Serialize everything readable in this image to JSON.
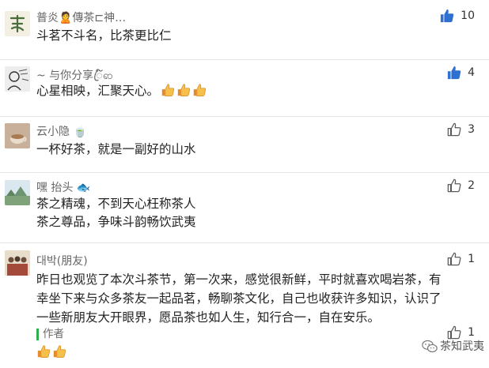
{
  "colors": {
    "like_active": "#2f6fd0",
    "like_inactive": "#5b5b5b",
    "author_tag_bar": "#2eaf4a",
    "name_text": "#666666"
  },
  "comments": [
    {
      "name": "普炎🙎傳茶⊏神…",
      "text_lines": [
        "斗茗不斗名，比茶更比仁"
      ],
      "likes": "10",
      "liked": true,
      "avatar_icon": "tea-character-avatar"
    },
    {
      "name": "~ 与你分享ꦿ໌ၹ",
      "text_lines": [
        "心星相映，汇聚天心。"
      ],
      "likes": "4",
      "liked": true,
      "emoji_count": 3,
      "avatar_icon": "sketch-portrait-avatar"
    },
    {
      "name": "云小隐 🍵",
      "text_lines": [
        "一杯好茶，就是一副好的山水"
      ],
      "likes": "3",
      "liked": false,
      "avatar_icon": "tea-cup-avatar"
    },
    {
      "name": "嘿 抬头 🐟",
      "text_lines": [
        "茶之精魂，不到天心枉称茶人",
        "茶之尊品，争味斗韵畅饮武夷"
      ],
      "likes": "2",
      "liked": false,
      "avatar_icon": "landscape-avatar"
    },
    {
      "name": "대박(朋友)",
      "text_lines": [
        "昨日也观览了本次斗茶节，第一次来，感觉很新鲜，平时就喜欢喝岩茶，有",
        "幸坐下来与众多茶友一起品茗，畅聊茶文化，自己也收获许多知识，认识了",
        "一些新朋友大开眼界，愿品茶也如人生，知行合一，自在安乐。"
      ],
      "likes": "1",
      "liked": false,
      "avatar_icon": "group-photo-avatar"
    }
  ],
  "author_reply": {
    "label": "作者",
    "likes": "1",
    "emoji_count": 2
  },
  "watermark": {
    "text": "茶知武夷",
    "icon": "wechat-logo-icon"
  }
}
